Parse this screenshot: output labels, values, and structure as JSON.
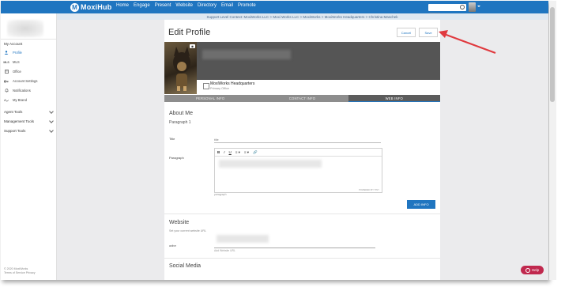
{
  "app": {
    "logo_text": "MoxiHub",
    "logo_mark": "M"
  },
  "nav": [
    "Home",
    "Engage",
    "Present",
    "Website",
    "Directory",
    "Email",
    "Promote"
  ],
  "search": {
    "placeholder": "Search"
  },
  "support_banner": "Support Level Context: MoxiWorks LLC > Moxi Works LLC > MoxiWorks > MoxiWorks Headquarters > Christina Maschek",
  "sidebar": {
    "my_account": "My Account",
    "items": [
      {
        "label": "Profile",
        "icon": "person-icon",
        "active": true
      },
      {
        "label": "MLS",
        "icon": "mls-icon",
        "active": false
      },
      {
        "label": "Office",
        "icon": "building-icon",
        "active": false
      },
      {
        "label": "Account Settings",
        "icon": "key-icon",
        "active": false
      },
      {
        "label": "Notifications",
        "icon": "bell-icon",
        "active": false
      },
      {
        "label": "My Brand",
        "icon": "signature-icon",
        "active": false
      }
    ],
    "sections": [
      "Agent Tools",
      "Management Tools",
      "Support Tools"
    ],
    "footer": [
      "© 2020 MoxiWorks",
      "Terms of Service  Privacy"
    ]
  },
  "page": {
    "title": "Edit Profile",
    "cancel": "Cancel",
    "save": "Save",
    "office_name": "MoxiWorks Headquarters",
    "office_label": "Primary Office",
    "tabs": [
      "PERSONAL INFO",
      "CONTACT INFO",
      "WEB INFO"
    ],
    "active_tab": "WEB INFO",
    "about_heading": "About Me",
    "about_sub": "Paragraph 1",
    "title_label": "Title",
    "title_placeholder": "title",
    "paragraph_label": "Paragraph",
    "toolbar": [
      "B",
      "I",
      "U",
      "≡ ▾",
      "≡ ▾",
      "🔗"
    ],
    "powered_by": "POWERED BY TINY",
    "paragraph_hint": "paragraph",
    "add_info": "ADD INFO",
    "website_heading": "Website",
    "website_sub": "Set your current website URL",
    "website_field_label": "active",
    "website_hint": "Add Website URL",
    "social_heading": "Social Media"
  },
  "help": "Help",
  "colors": {
    "brand": "#1f75c0",
    "help": "#c0284e",
    "arrow": "#e0393e"
  }
}
